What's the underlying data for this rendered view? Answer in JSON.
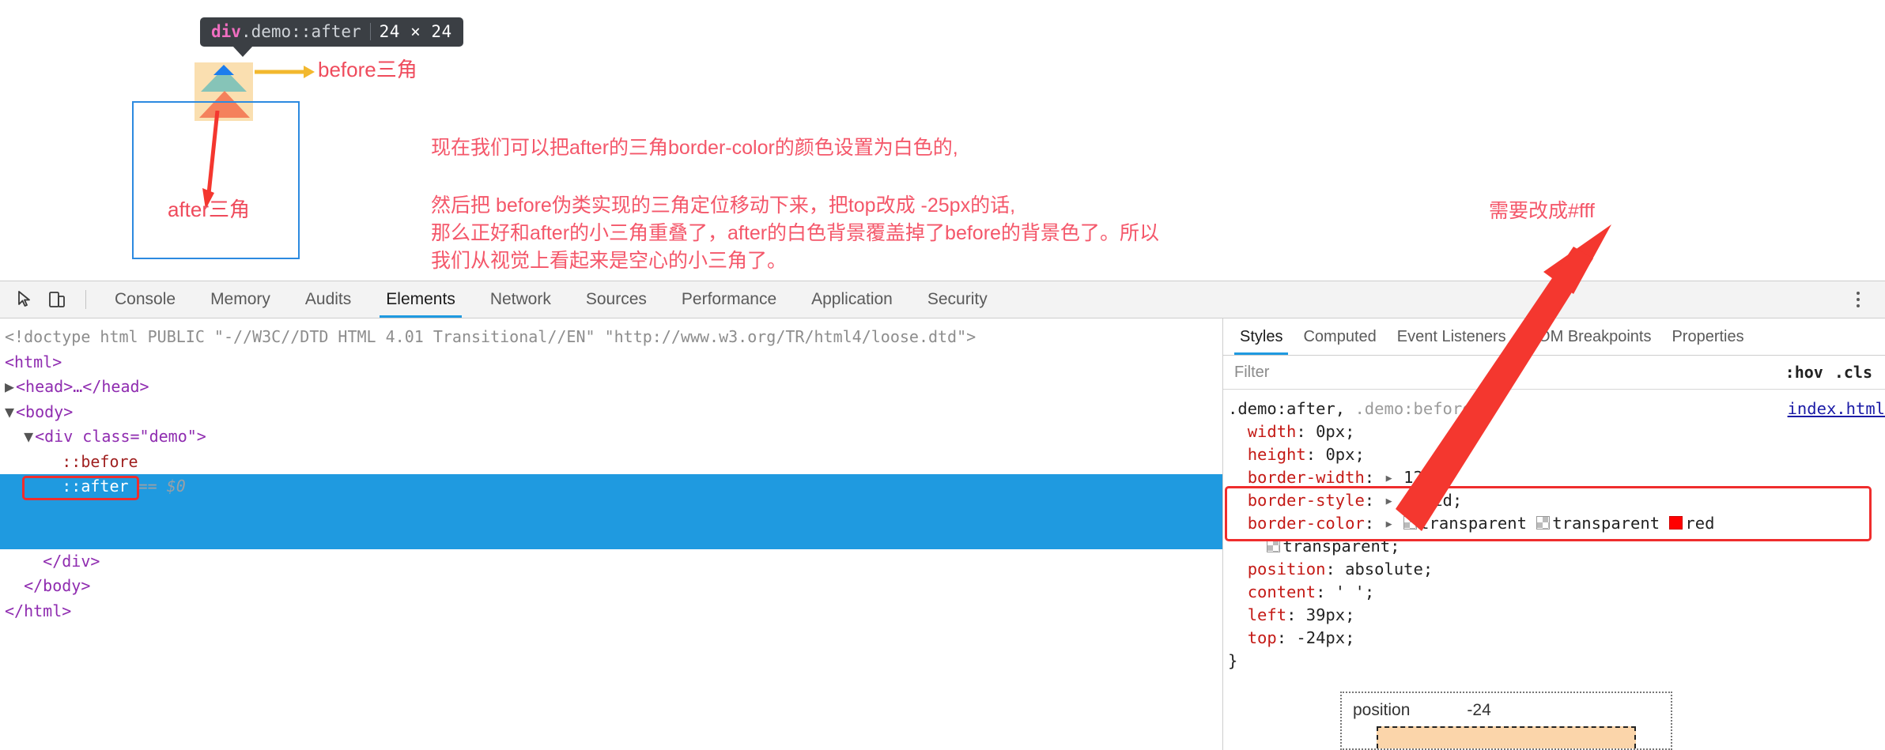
{
  "page": {
    "element_badge": {
      "tag": "div",
      "class_pseudo": ".demo::after",
      "size": "24 × 24"
    },
    "labels": {
      "before_triangle": "before三角",
      "after_triangle": "after三角",
      "right_note": "需要改成#fff"
    },
    "notes": {
      "line1": "现在我们可以把after的三角border-color的颜色设置为白色的,",
      "line2": "然后把 before伪类实现的三角定位移动下来，把top改成 -25px的话,",
      "line3": "那么正好和after的小三角重叠了，after的白色背景覆盖掉了before的背景色了。所以",
      "line4": "我们从视觉上看起来是空心的小三角了。"
    }
  },
  "devtools": {
    "toolbar": {
      "inspect_icon": "cursor-inspect-icon",
      "device_icon": "device-toolbar-icon",
      "more_icon": "more-vertical-icon",
      "tabs": [
        {
          "label": "Console",
          "active": false
        },
        {
          "label": "Memory",
          "active": false
        },
        {
          "label": "Audits",
          "active": false
        },
        {
          "label": "Elements",
          "active": true
        },
        {
          "label": "Network",
          "active": false
        },
        {
          "label": "Sources",
          "active": false
        },
        {
          "label": "Performance",
          "active": false
        },
        {
          "label": "Application",
          "active": false
        },
        {
          "label": "Security",
          "active": false
        }
      ]
    },
    "dom_tree": {
      "doctype": "<!doctype html PUBLIC \"-//W3C//DTD HTML 4.01 Transitional//EN\" \"http://www.w3.org/TR/html4/loose.dtd\">",
      "html_open": "<html>",
      "head_collapsed": "<head>…</head>",
      "body_open": "<body>",
      "div_open": "<div class=\"demo\">",
      "before_pseudo": "::before",
      "after_pseudo": "::after",
      "after_marker": "== $0",
      "div_close": "</div>",
      "body_close": "</body>",
      "html_close": "</html>"
    },
    "styles_panel": {
      "tabs": [
        {
          "label": "Styles",
          "active": true
        },
        {
          "label": "Computed",
          "active": false
        },
        {
          "label": "Event Listeners",
          "active": false
        },
        {
          "label": "DOM Breakpoints",
          "active": false
        },
        {
          "label": "Properties",
          "active": false
        }
      ],
      "filter_placeholder": "Filter",
      "filter_value": "",
      "toggle_hov": ":hov",
      "toggle_cls": ".cls",
      "rule": {
        "selector_primary": ".demo:after,",
        "selector_secondary": ".demo:before",
        "brace_open": "{",
        "brace_close": "}",
        "source": "index.html",
        "declarations": [
          {
            "property": "width",
            "value": "0px",
            "expandable": false
          },
          {
            "property": "height",
            "value": "0px",
            "expandable": false
          },
          {
            "property": "border-width",
            "value": "12px",
            "expandable": true
          },
          {
            "property": "border-style",
            "value": "solid",
            "expandable": true
          },
          {
            "property": "position",
            "value": "absolute",
            "expandable": false
          },
          {
            "property": "content",
            "value": "' '",
            "expandable": false
          },
          {
            "property": "left",
            "value": "39px",
            "expandable": false
          },
          {
            "property": "top",
            "value": "-24px",
            "expandable": false
          }
        ],
        "border_color": {
          "property": "border-color",
          "parts": [
            "transparent",
            "transparent",
            "red",
            "transparent"
          ],
          "swatch_red_hex": "#ff0000"
        }
      },
      "box_model": {
        "label": "position",
        "value": "-24"
      }
    }
  },
  "colors": {
    "accent_blue": "#1f9ae0",
    "annotation_red": "#f4576a",
    "highlight_red": "#ef2d2d",
    "padding_box": "#fadfb0",
    "content_box": "#86c4b8",
    "margin_box": "#f4815c",
    "demo_border": "#2c8ae0",
    "badge_bg": "#3b3f44"
  }
}
